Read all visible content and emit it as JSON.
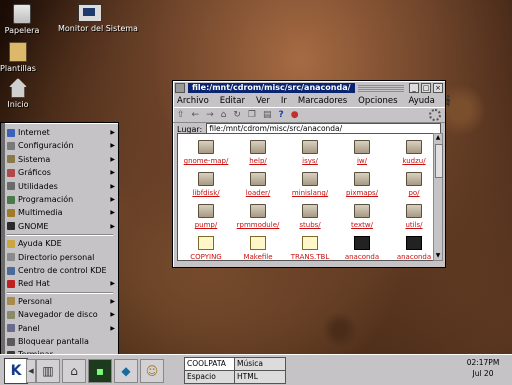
{
  "desktop": {
    "icons": [
      {
        "label": "Papelera",
        "icon": "trash-icon"
      },
      {
        "label": "Monitor del Sistema",
        "icon": "monitor-icon"
      },
      {
        "label": "Plantillas",
        "icon": "folder-icon"
      },
      {
        "label": "Inicio",
        "icon": "home-icon"
      }
    ]
  },
  "window": {
    "title": "file:/mnt/cdrom/misc/src/anaconda/",
    "menu": [
      "Archivo",
      "Editar",
      "Ver",
      "Ir",
      "Marcadores",
      "Opciones",
      "Ayuda"
    ],
    "toolbar": [
      "up-arrow-icon",
      "back-arrow-icon",
      "forward-arrow-icon",
      "home-icon",
      "reload-icon",
      "copy-icon",
      "paste-icon",
      "help-icon",
      "stop-icon"
    ],
    "help_glyph": "?",
    "location_label": "Lugar:",
    "location_value": "file:/mnt/cdrom/misc/src/anaconda/",
    "files": [
      {
        "name": "gnome-map/",
        "type": "folder"
      },
      {
        "name": "help/",
        "type": "folder"
      },
      {
        "name": "isys/",
        "type": "folder"
      },
      {
        "name": "iw/",
        "type": "folder"
      },
      {
        "name": "kudzu/",
        "type": "folder"
      },
      {
        "name": "libfdisk/",
        "type": "folder"
      },
      {
        "name": "loader/",
        "type": "folder"
      },
      {
        "name": "minislang/",
        "type": "folder"
      },
      {
        "name": "pixmaps/",
        "type": "folder"
      },
      {
        "name": "po/",
        "type": "folder"
      },
      {
        "name": "pump/",
        "type": "folder"
      },
      {
        "name": "rpmmodule/",
        "type": "folder"
      },
      {
        "name": "stubs/",
        "type": "folder"
      },
      {
        "name": "textw/",
        "type": "folder"
      },
      {
        "name": "utils/",
        "type": "folder"
      },
      {
        "name": "COPYING",
        "type": "doc"
      },
      {
        "name": "Makefile",
        "type": "doc"
      },
      {
        "name": "TRANS.TBL",
        "type": "doc"
      },
      {
        "name": "anaconda",
        "type": "exec"
      },
      {
        "name": "anaconda",
        "type": "exec"
      }
    ]
  },
  "startmenu": {
    "items": [
      {
        "label": "Internet",
        "submenu": true,
        "color": "#3a62b8"
      },
      {
        "label": "Configuración",
        "submenu": true,
        "color": "#7a7a7a"
      },
      {
        "label": "Sistema",
        "submenu": true,
        "color": "#8a7a4a"
      },
      {
        "label": "Gráficos",
        "submenu": true,
        "color": "#b04a4a"
      },
      {
        "label": "Utilidades",
        "submenu": true,
        "color": "#6a6a6a"
      },
      {
        "label": "Programación",
        "submenu": true,
        "color": "#4a7a4a"
      },
      {
        "label": "Multimedia",
        "submenu": true,
        "color": "#a07a2a"
      },
      {
        "label": "GNOME",
        "submenu": true,
        "color": "#2a2a2a"
      },
      {
        "label": "Ayuda KDE",
        "submenu": false,
        "color": "#c9a640"
      },
      {
        "label": "Directorio personal",
        "submenu": false,
        "color": "#8a8a8a"
      },
      {
        "label": "Centro de control KDE",
        "submenu": false,
        "color": "#4a6a9a"
      },
      {
        "label": "Red Hat",
        "submenu": true,
        "color": "#c02020"
      },
      {
        "label": "Personal",
        "submenu": true,
        "color": "#a88a4a"
      },
      {
        "label": "Navegador de disco",
        "submenu": true,
        "color": "#8a8a6a"
      },
      {
        "label": "Panel",
        "submenu": true,
        "color": "#6a6a8a"
      },
      {
        "label": "Bloquear pantalla",
        "submenu": false,
        "color": "#5a5a5a"
      },
      {
        "label": "Terminar",
        "submenu": false,
        "color": "#3a3a3a"
      }
    ]
  },
  "taskbar": {
    "k_label": "K",
    "pager": [
      {
        "label": "COOLPATA",
        "active": true
      },
      {
        "label": "Música",
        "active": false
      },
      {
        "label": "Espacio",
        "active": false
      },
      {
        "label": "HTML",
        "active": false
      }
    ],
    "time": "02:17PM",
    "date": "Jul 20"
  }
}
